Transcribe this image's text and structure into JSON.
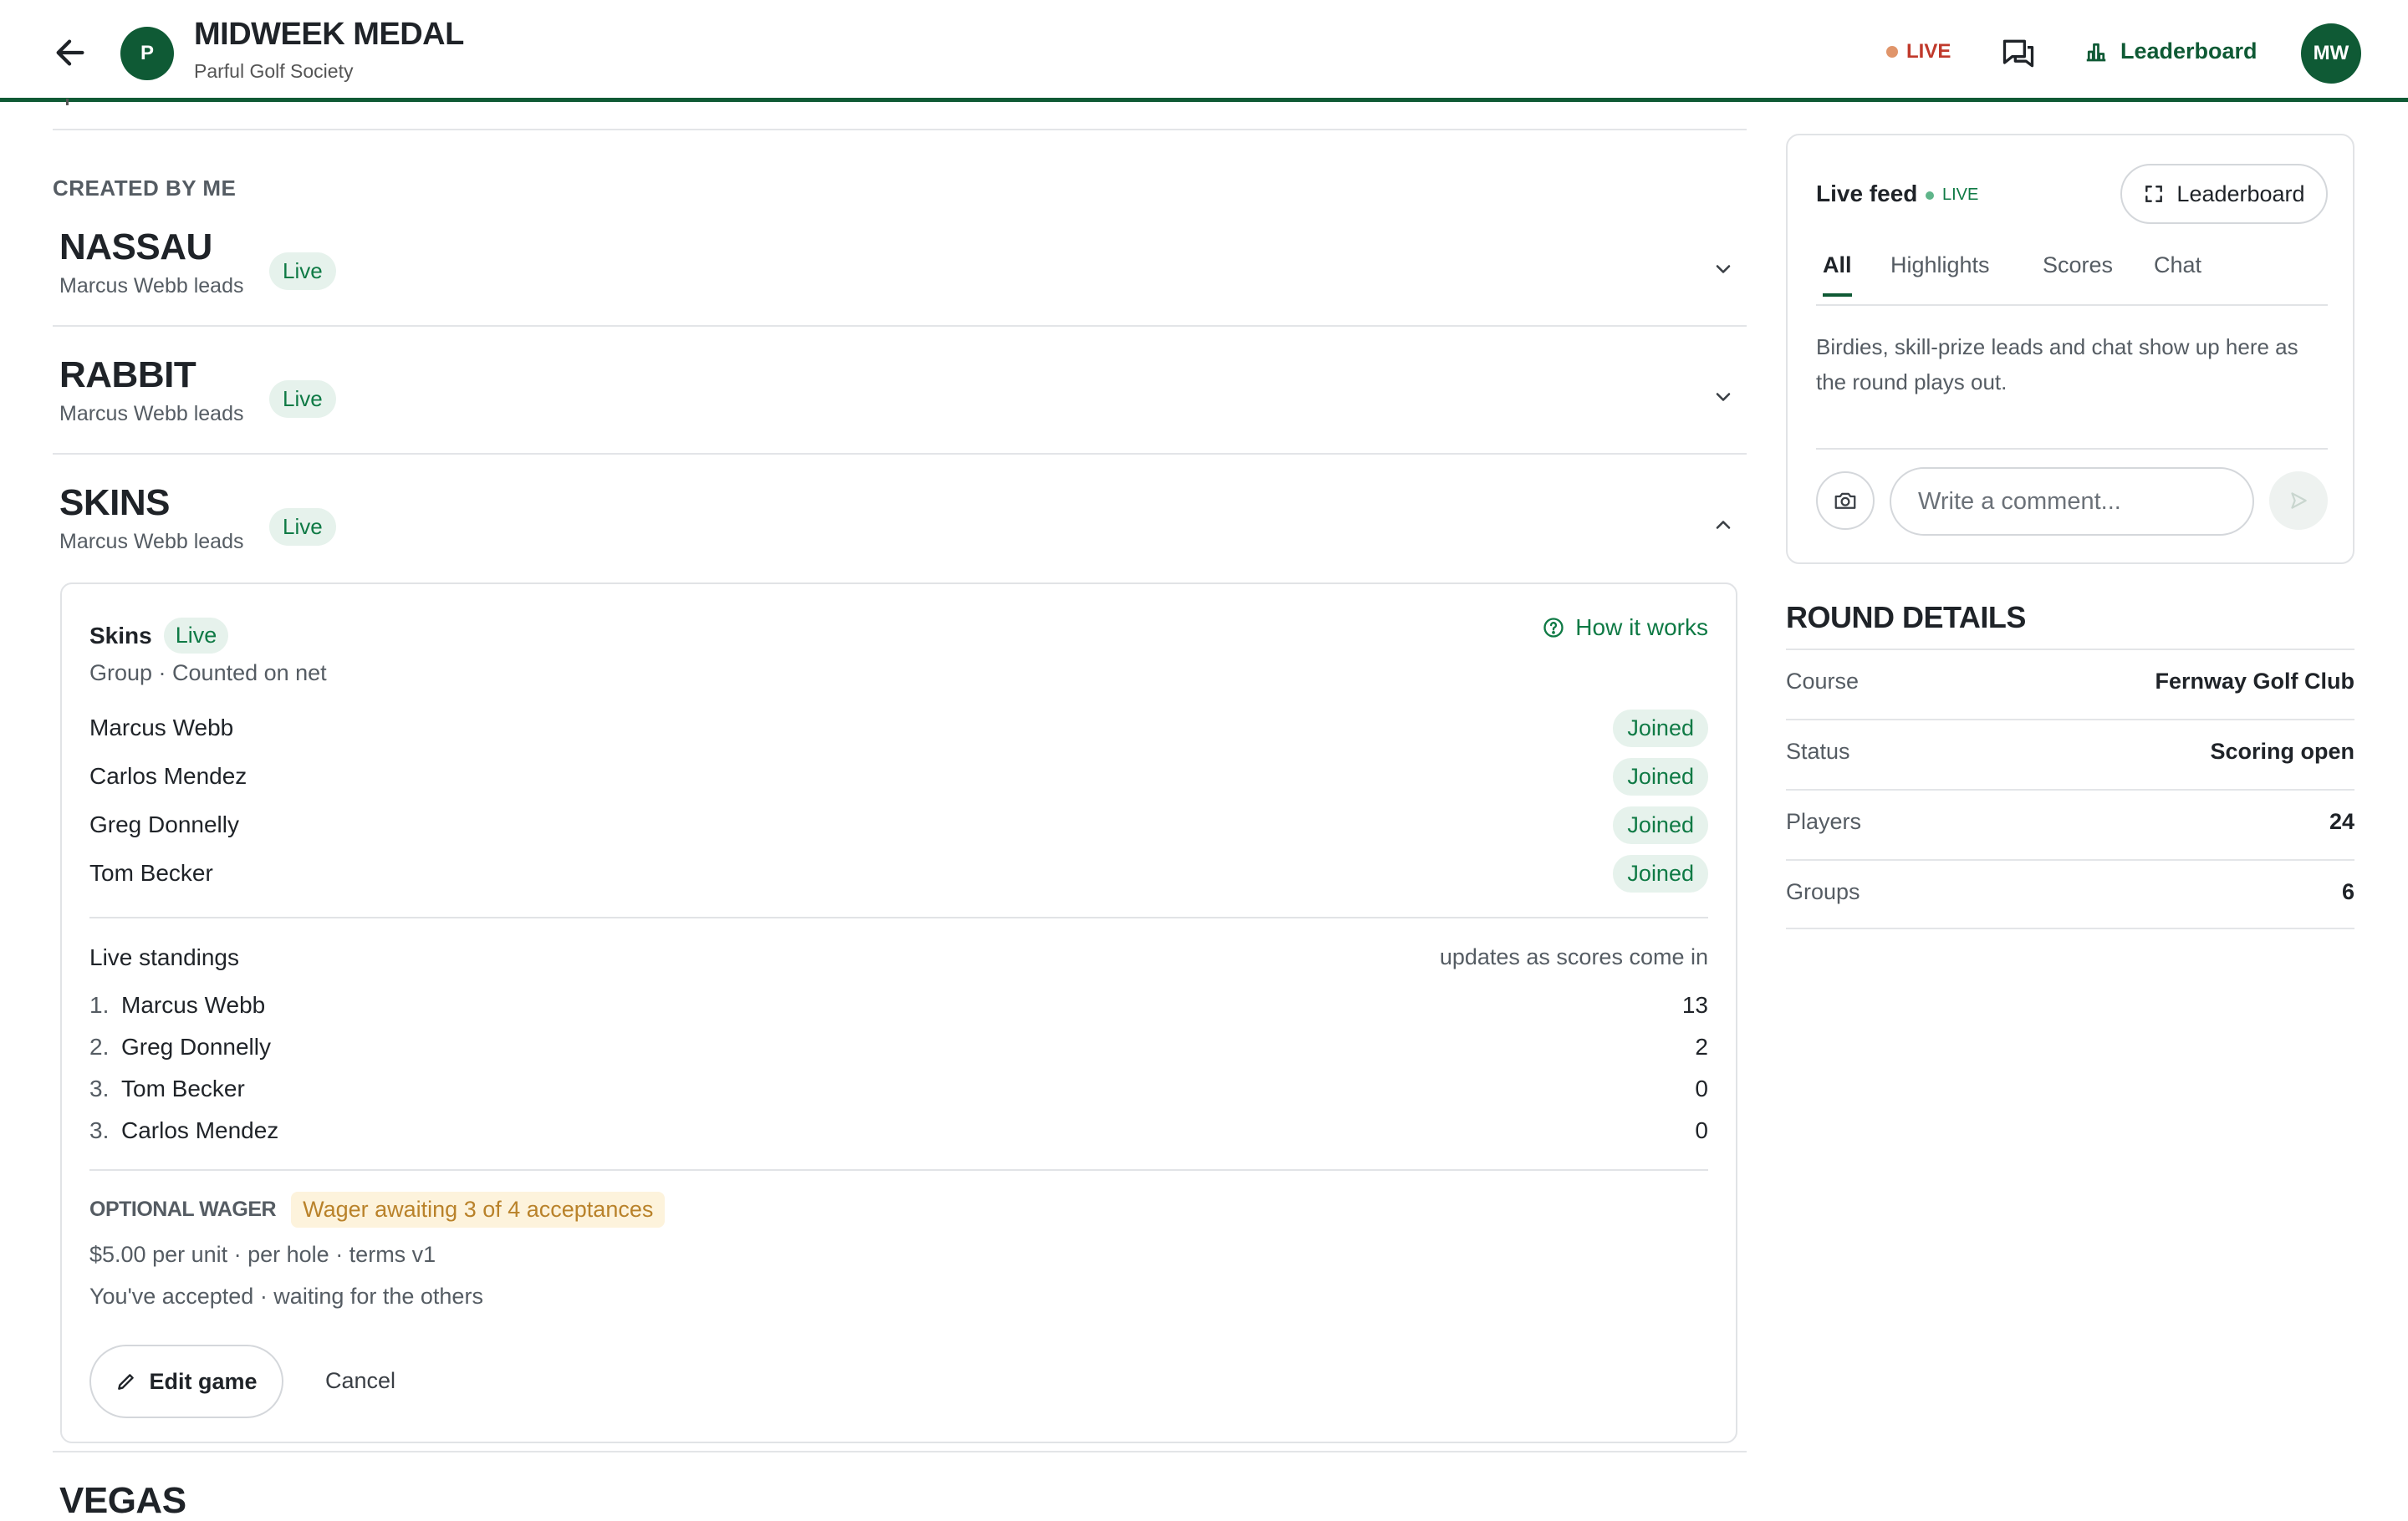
{
  "header": {
    "title": "MIDWEEK MEDAL",
    "subtitle": "Parful Golf Society",
    "logo_initial": "P",
    "live_label": "LIVE",
    "leaderboard_label": "Leaderboard",
    "avatar_initials": "MW"
  },
  "main": {
    "section_label": "CREATED BY ME",
    "games": [
      {
        "name": "NASSAU",
        "leader": "Marcus Webb leads",
        "status": "Live",
        "expanded": false
      },
      {
        "name": "RABBIT",
        "leader": "Marcus Webb leads",
        "status": "Live",
        "expanded": false
      },
      {
        "name": "SKINS",
        "leader": "Marcus Webb leads",
        "status": "Live",
        "expanded": true
      },
      {
        "name": "VEGAS",
        "leader": "",
        "status": "",
        "expanded": false
      }
    ],
    "card": {
      "title": "Skins",
      "status": "Live",
      "how_it_works": "How it works",
      "meta": "Group · Counted on net",
      "participants": [
        {
          "name": "Marcus Webb",
          "status": "Joined"
        },
        {
          "name": "Carlos Mendez",
          "status": "Joined"
        },
        {
          "name": "Greg Donnelly",
          "status": "Joined"
        },
        {
          "name": "Tom Becker",
          "status": "Joined"
        }
      ],
      "standings_title": "Live standings",
      "standings_note": "updates as scores come in",
      "standings": [
        {
          "rank": "1.",
          "name": "Marcus Webb",
          "value": "13"
        },
        {
          "rank": "2.",
          "name": "Greg Donnelly",
          "value": "2"
        },
        {
          "rank": "3.",
          "name": "Tom Becker",
          "value": "0"
        },
        {
          "rank": "3.",
          "name": "Carlos Mendez",
          "value": "0"
        }
      ],
      "wager_label": "OPTIONAL WAGER",
      "wager_badge": "Wager awaiting 3 of 4 acceptances",
      "wager_terms": "$5.00 per unit · per hole · terms v1",
      "wager_status": "You've accepted · waiting for the others",
      "edit_label": "Edit game",
      "cancel_label": "Cancel"
    }
  },
  "feed": {
    "title": "Live feed",
    "live_label": "LIVE",
    "leaderboard_button": "Leaderboard",
    "tabs": [
      {
        "label": "All",
        "active": true
      },
      {
        "label": "Highlights",
        "active": false
      },
      {
        "label": "Scores",
        "active": false
      },
      {
        "label": "Chat",
        "active": false
      }
    ],
    "empty_text": "Birdies, skill-prize leads and chat show up here as the round plays out.",
    "comment_placeholder": "Write a comment..."
  },
  "round_details": {
    "title": "ROUND DETAILS",
    "rows": [
      {
        "label": "Course",
        "value": "Fernway Golf Club"
      },
      {
        "label": "Status",
        "value": "Scoring open"
      },
      {
        "label": "Players",
        "value": "24"
      },
      {
        "label": "Groups",
        "value": "6"
      }
    ]
  },
  "colors": {
    "brand": "#0f5a35",
    "live_red": "#c0392b",
    "badge_green_bg": "#e6f2ec",
    "badge_green_text": "#0f7a45",
    "wager_bg": "#fdf3dc",
    "wager_text": "#b9822a"
  },
  "icons": [
    "back-arrow-icon",
    "chat-icon",
    "bar-chart-icon",
    "chevron-down-icon",
    "chevron-up-icon",
    "help-circle-icon",
    "pencil-icon",
    "expand-icon",
    "camera-icon",
    "send-icon"
  ]
}
